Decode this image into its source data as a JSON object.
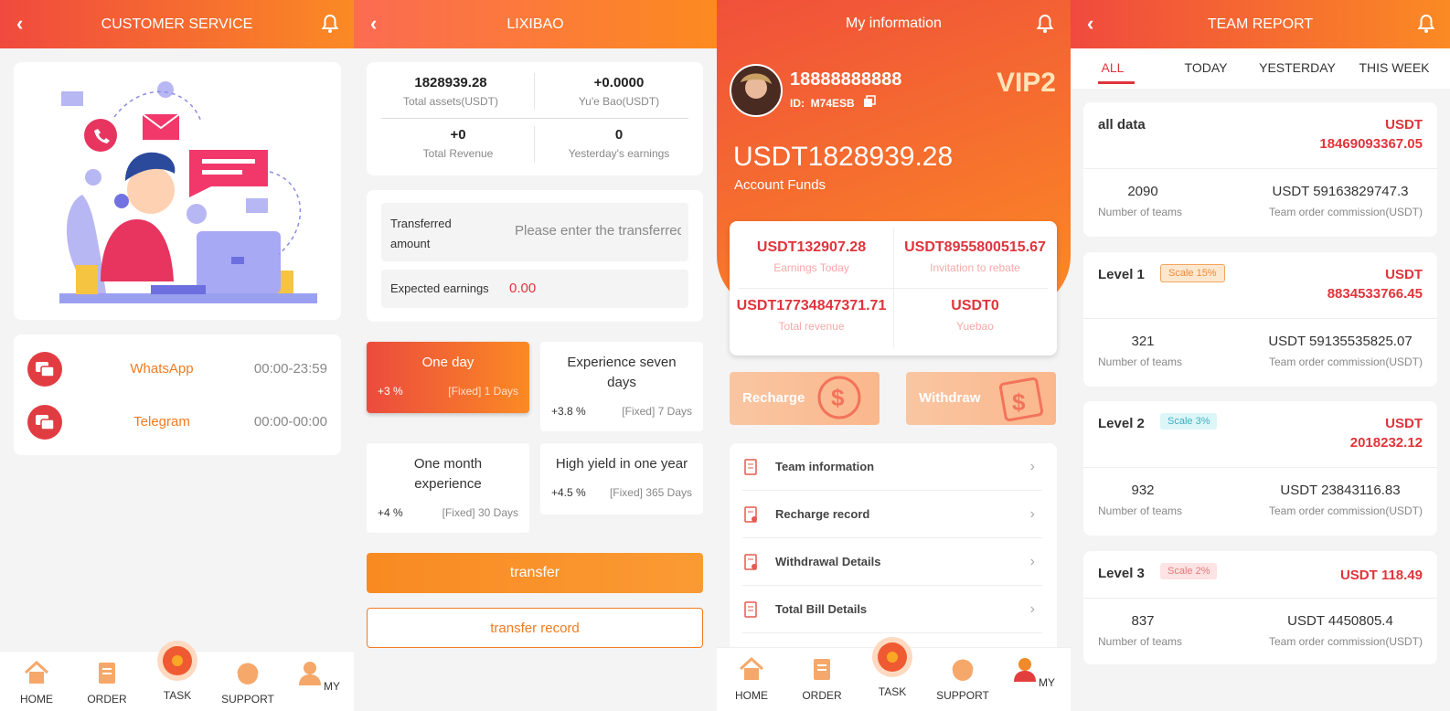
{
  "panel1": {
    "header": {
      "title": "CUSTOMER SERVICE"
    },
    "contacts": [
      {
        "name": "WhatsApp",
        "hours": "00:00-23:59"
      },
      {
        "name": "Telegram",
        "hours": "00:00-00:00"
      }
    ]
  },
  "panel2": {
    "header": {
      "title": "LIXIBAO"
    },
    "stats": [
      {
        "value": "1828939.28",
        "label": "Total assets(USDT)"
      },
      {
        "value": "+0.0000",
        "label": "Yu'e Bao(USDT)"
      },
      {
        "value": "+0",
        "label": "Total Revenue"
      },
      {
        "value": "0",
        "label": "Yesterday's earnings"
      }
    ],
    "transfer": {
      "amount_label_1": "Transferred",
      "amount_label_2": "amount",
      "amount_placeholder": "Please enter the transferred amount",
      "expected_label": "Expected earnings",
      "expected_value": "0.00"
    },
    "plans": [
      {
        "title": "One day",
        "rate": "+3 %",
        "fixed": "[Fixed] 1 Days",
        "selected": true
      },
      {
        "title": "Experience seven days",
        "rate": "+3.8 %",
        "fixed": "[Fixed] 7 Days"
      },
      {
        "title": "One month experience",
        "rate": "+4 %",
        "fixed": "[Fixed] 30 Days"
      },
      {
        "title": "High yield in one year",
        "rate": "+4.5 %",
        "fixed": "[Fixed] 365 Days"
      }
    ],
    "buttons": {
      "transfer": "transfer",
      "record": "transfer record"
    }
  },
  "panel3": {
    "header": {
      "title": "My information"
    },
    "user": {
      "phone": "18888888888",
      "id_label": "ID:",
      "id": "M74ESB",
      "vip": "VIP2"
    },
    "funds": {
      "value": "USDT1828939.28",
      "label": "Account Funds"
    },
    "stats": [
      {
        "value": "USDT132907.28",
        "label": "Earnings Today"
      },
      {
        "value": "USDT8955800515.67",
        "label": "Invitation to rebate"
      },
      {
        "value": "USDT17734847371.71",
        "label": "Total revenue"
      },
      {
        "value": "USDT0",
        "label": "Yuebao"
      }
    ],
    "actions": {
      "recharge": "Recharge",
      "withdraw": "Withdraw"
    },
    "menu": [
      "Team information",
      "Recharge record",
      "Withdrawal Details",
      "Total Bill Details"
    ]
  },
  "panel4": {
    "header": {
      "title": "TEAM REPORT"
    },
    "tabs": [
      "ALL",
      "TODAY",
      "YESTERDAY",
      "THIS WEEK"
    ],
    "reports": [
      {
        "name": "all data",
        "badge": "",
        "amount_1": "USDT",
        "amount_2": "18469093367.05",
        "teams": "2090",
        "teams_label": "Number of teams",
        "commission": "USDT 59163829747.3",
        "commission_label": "Team order commission(USDT)"
      },
      {
        "name": "Level 1",
        "badge": "Scale 15%",
        "amount_1": "USDT",
        "amount_2": "8834533766.45",
        "teams": "321",
        "teams_label": "Number of teams",
        "commission": "USDT 59135535825.07",
        "commission_label": "Team order commission(USDT)"
      },
      {
        "name": "Level 2",
        "badge": "Scale 3%",
        "amount_1": "USDT",
        "amount_2": "2018232.12",
        "teams": "932",
        "teams_label": "Number of teams",
        "commission": "USDT 23843116.83",
        "commission_label": "Team order commission(USDT)"
      },
      {
        "name": "Level 3",
        "badge": "Scale 2%",
        "amount_1": "USDT 118.49",
        "amount_2": "",
        "teams": "837",
        "teams_label": "Number of teams",
        "commission": "USDT 4450805.4",
        "commission_label": "Team order commission(USDT)"
      }
    ]
  },
  "nav": [
    "HOME",
    "ORDER",
    "TASK",
    "SUPPORT",
    "MY"
  ],
  "colors": {
    "accent_start": "#f04a3e",
    "accent_end": "#fb8a24",
    "text_red": "#e0343b",
    "text_orange": "#f37b20"
  }
}
